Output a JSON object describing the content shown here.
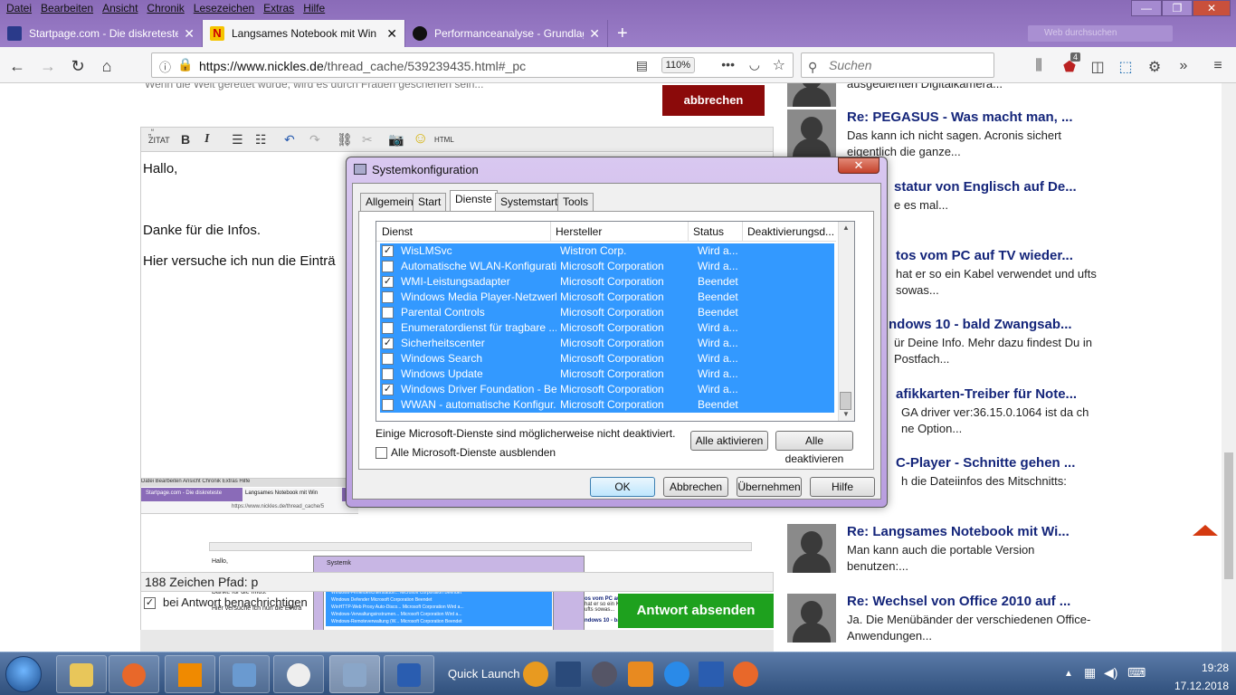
{
  "browser": {
    "menu": [
      "Datei",
      "Bearbeiten",
      "Ansicht",
      "Chronik",
      "Lesezeichen",
      "Extras",
      "Hilfe"
    ],
    "tabs": [
      {
        "title": "Startpage.com - Die diskreteste",
        "active": false
      },
      {
        "title": "Langsames Notebook mit Win",
        "active": true
      },
      {
        "title": "Performanceanalyse - Grundlag",
        "active": false
      }
    ],
    "window_controls": {
      "minimize": "—",
      "maximize": "❐",
      "close": "✕"
    },
    "url_domain": "https://www.nickles.de",
    "url_path": "/thread_cache/539239435.html#_pc",
    "zoom": "110%",
    "search_placeholder": "Suchen",
    "faded_search": "Web durchsuchen",
    "badge": "4",
    "colors": {
      "titlebar": "#8a6bb8",
      "accent": "#3399ff"
    }
  },
  "editor": {
    "top_note": "Wenn die Welt gerettet würde, wird es durch Frauen geschehen sein...",
    "cancel_label": "abbrechen",
    "toolbar": {
      "quote": "„“\nZITAT",
      "bold": "B",
      "italic": "I",
      "html": "HTML"
    },
    "lines": [
      "Hallo,",
      "Danke für die Infos.",
      "Hier versuche ich nun die Einträ"
    ],
    "status": "188 Zeichen Pfad: p",
    "notify_label": "bei Antwort benachrichtigen",
    "send_label": "Antwort absenden"
  },
  "mini": {
    "menu": "Datei  Bearbeiten  Ansicht  Chronik  Extras  Hilfe",
    "tab1": "Startpage.com - Die diskreteste",
    "tab2": "Langsames Notebook mit Win",
    "url": "https://www.nickles.de/thread_cache/5",
    "lines": [
      "Hallo,",
      "Danke für die Infos.",
      "Hier versuche ich nun die Einträ"
    ],
    "dlg_title": "Systemk",
    "rows": [
      "Windows-Fehlerberichterstattun... Microsoft Corporation Beendet",
      "Windows Defender Microsoft Corporation Beendet",
      "WinHTTP-Web Proxy Auto-Disco... Microsoft Corporation Wird a...",
      "Windows-Verwaltungsinstrumen... Microsoft Corporation Wird a...",
      "Windows-Remoteverwaltung (W... Microsoft Corporation Beendet"
    ],
    "right_lines": [
      "os vom PC auf TV wieder...",
      "hat er so ein Kabel verwendet und",
      "ufts sowas...",
      "ndows 10 - bald Zwangsab..."
    ]
  },
  "posts": [
    {
      "title": "",
      "body": "ausgedienten Digitalkamera..."
    },
    {
      "title": "Re: PEGASUS - Was macht man, ...",
      "body": "Das kann ich nicht sagen. Acronis sichert eigentlich die ganze..."
    },
    {
      "title": "statur von Englisch auf De...",
      "body": "e es mal..."
    },
    {
      "title": "tos vom PC auf TV wieder...",
      "body": "hat er so ein Kabel verwendet und ufts sowas..."
    },
    {
      "title": "ndows 10 - bald Zwangsab...",
      "body": "ür Deine Info. Mehr dazu findest Du in Postfach..."
    },
    {
      "title": "afikkarten-Treiber für Note...",
      "body": "GA driver ver:36.15.0.1064 ist da ch ne Option..."
    },
    {
      "title": "C-Player - Schnitte gehen ...",
      "body": "h die Dateiinfos des Mitschnitts:"
    },
    {
      "title": "Re: Langsames Notebook mit Wi...",
      "body": "Man kann auch die portable Version benutzen:..."
    },
    {
      "title": "Re: Wechsel von Office 2010 auf ...",
      "body": "Ja. Die Menübänder der verschiedenen Office-Anwendungen..."
    }
  ],
  "dialog": {
    "title": "Systemkonfiguration",
    "tabs": [
      "Allgemein",
      "Start",
      "Dienste",
      "Systemstart",
      "Tools"
    ],
    "active_tab": "Dienste",
    "columns": [
      "Dienst",
      "Hersteller",
      "Status",
      "Deaktivierungsd..."
    ],
    "rows": [
      {
        "name": "WisLMSvc",
        "maker": "Wistron Corp.",
        "status": "Wird a...",
        "checked": "✓"
      },
      {
        "name": "Automatische WLAN-Konfiguration",
        "maker": "Microsoft Corporation",
        "status": "Wird a...",
        "checked": ""
      },
      {
        "name": "WMI-Leistungsadapter",
        "maker": "Microsoft Corporation",
        "status": "Beendet",
        "checked": "✓"
      },
      {
        "name": "Windows Media Player-Netzwerk...",
        "maker": "Microsoft Corporation",
        "status": "Beendet",
        "checked": ""
      },
      {
        "name": "Parental Controls",
        "maker": "Microsoft Corporation",
        "status": "Beendet",
        "checked": ""
      },
      {
        "name": "Enumeratordienst für tragbare ...",
        "maker": "Microsoft Corporation",
        "status": "Wird a...",
        "checked": ""
      },
      {
        "name": "Sicherheitscenter",
        "maker": "Microsoft Corporation",
        "status": "Wird a...",
        "checked": "✓"
      },
      {
        "name": "Windows Search",
        "maker": "Microsoft Corporation",
        "status": "Wird a...",
        "checked": ""
      },
      {
        "name": "Windows Update",
        "maker": "Microsoft Corporation",
        "status": "Wird a...",
        "checked": ""
      },
      {
        "name": "Windows Driver Foundation - Be...",
        "maker": "Microsoft Corporation",
        "status": "Wird a...",
        "checked": "✓"
      },
      {
        "name": "WWAN - automatische Konfigur...",
        "maker": "Microsoft Corporation",
        "status": "Beendet",
        "checked": ""
      }
    ],
    "note": "Einige Microsoft-Dienste sind möglicherweise nicht deaktiviert.",
    "enable_all": "Alle aktivieren",
    "disable_all": "Alle deaktivieren",
    "hide_ms": "Alle Microsoft-Dienste ausblenden",
    "ok": "OK",
    "cancel": "Abbrechen",
    "apply": "Übernehmen",
    "help": "Hilfe",
    "close": "✕"
  },
  "taskbar": {
    "quick_launch": "Quick Launch",
    "time": "19:28",
    "date": "17.12.2018"
  }
}
